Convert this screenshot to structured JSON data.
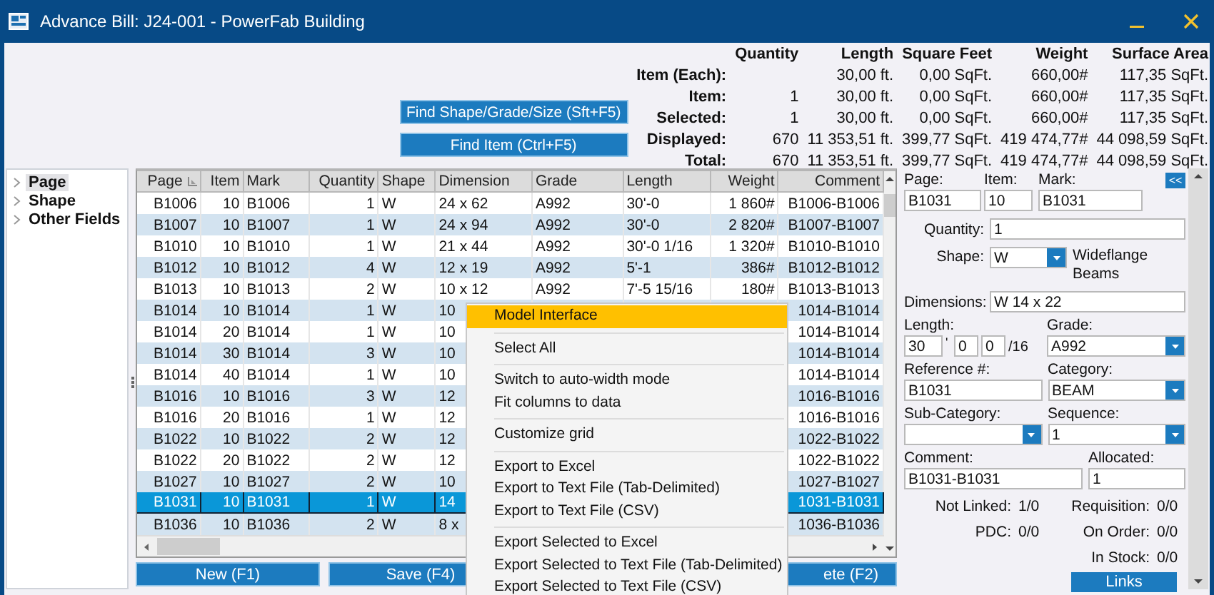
{
  "window": {
    "title": "Advance Bill: J24-001 - PowerFab Building"
  },
  "find_buttons": [
    "Find Shape/Grade/Size (Sft+F5)",
    "Find Item (Ctrl+F5)"
  ],
  "summary": {
    "columns": [
      "Quantity",
      "Length",
      "Square Feet",
      "Weight",
      "Surface Area"
    ],
    "rows": [
      {
        "label": "Item (Each):",
        "length": "30,00 ft.",
        "square_feet": "0,00 SqFt.",
        "weight": "660,00#",
        "surface_area": "117,35 SqFt."
      },
      {
        "label": "Item:",
        "quantity": "1",
        "length": "30,00 ft.",
        "square_feet": "0,00 SqFt.",
        "weight": "660,00#",
        "surface_area": "117,35 SqFt."
      },
      {
        "label": "Selected:",
        "quantity": "1",
        "length": "30,00 ft.",
        "square_feet": "0,00 SqFt.",
        "weight": "660,00#",
        "surface_area": "117,35 SqFt."
      },
      {
        "label": "Displayed:",
        "quantity": "670",
        "length": "11 353,51 ft.",
        "square_feet": "399,77 SqFt.",
        "weight": "419 474,77#",
        "surface_area": "44 098,59 SqFt."
      },
      {
        "label": "Total:",
        "quantity": "670",
        "length": "11 353,51 ft.",
        "square_feet": "399,77 SqFt.",
        "weight": "419 474,77#",
        "surface_area": "44 098,59 SqFt."
      }
    ]
  },
  "tree": [
    {
      "label": "Page",
      "selected": true
    },
    {
      "label": "Shape",
      "selected": false
    },
    {
      "label": "Other Fields",
      "selected": false
    }
  ],
  "grid": {
    "columns": [
      {
        "label": "Page",
        "sorted": true
      },
      {
        "label": "Item",
        "sorted": false
      },
      {
        "label": "Mark",
        "sorted": false
      },
      {
        "label": "Quantity",
        "sorted": false
      },
      {
        "label": "Shape",
        "sorted": false
      },
      {
        "label": "Dimension",
        "sorted": false
      },
      {
        "label": "Grade",
        "sorted": false
      },
      {
        "label": "Length",
        "sorted": false
      },
      {
        "label": "Weight",
        "sorted": false
      },
      {
        "label": "Comment",
        "sorted": false
      }
    ],
    "rows": [
      {
        "page": "B1006",
        "item": "10",
        "mark": "B1006",
        "quantity": "1",
        "shape": "W",
        "dimension": "24 x 62",
        "grade": "A992",
        "length": "30'-0",
        "weight": "1 860#",
        "comment": "B1006-B1006",
        "selected": false
      },
      {
        "page": "B1007",
        "item": "10",
        "mark": "B1007",
        "quantity": "1",
        "shape": "W",
        "dimension": "24 x 94",
        "grade": "A992",
        "length": "30'-0",
        "weight": "2 820#",
        "comment": "B1007-B1007",
        "selected": false
      },
      {
        "page": "B1010",
        "item": "10",
        "mark": "B1010",
        "quantity": "1",
        "shape": "W",
        "dimension": "21 x 44",
        "grade": "A992",
        "length": "30'-0 1/16",
        "weight": "1 320#",
        "comment": "B1010-B1010",
        "selected": false
      },
      {
        "page": "B1012",
        "item": "10",
        "mark": "B1012",
        "quantity": "4",
        "shape": "W",
        "dimension": "12 x 19",
        "grade": "A992",
        "length": "5'-1",
        "weight": "386#",
        "comment": "B1012-B1012",
        "selected": false
      },
      {
        "page": "B1013",
        "item": "10",
        "mark": "B1013",
        "quantity": "2",
        "shape": "W",
        "dimension": "10 x 12",
        "grade": "A992",
        "length": "7'-5 15/16",
        "weight": "180#",
        "comment": "B1013-B1013",
        "selected": false
      },
      {
        "page": "B1014",
        "item": "10",
        "mark": "B1014",
        "quantity": "1",
        "shape": "W",
        "dimension": "10",
        "comment": "1014-B1014",
        "selected": false
      },
      {
        "page": "B1014",
        "item": "20",
        "mark": "B1014",
        "quantity": "1",
        "shape": "W",
        "dimension": "10",
        "comment": "1014-B1014",
        "selected": false
      },
      {
        "page": "B1014",
        "item": "30",
        "mark": "B1014",
        "quantity": "3",
        "shape": "W",
        "dimension": "10",
        "comment": "1014-B1014",
        "selected": false
      },
      {
        "page": "B1014",
        "item": "40",
        "mark": "B1014",
        "quantity": "1",
        "shape": "W",
        "dimension": "10",
        "comment": "1014-B1014",
        "selected": false
      },
      {
        "page": "B1016",
        "item": "10",
        "mark": "B1016",
        "quantity": "3",
        "shape": "W",
        "dimension": "12",
        "comment": "1016-B1016",
        "selected": false
      },
      {
        "page": "B1016",
        "item": "20",
        "mark": "B1016",
        "quantity": "1",
        "shape": "W",
        "dimension": "12",
        "comment": "1016-B1016",
        "selected": false
      },
      {
        "page": "B1022",
        "item": "10",
        "mark": "B1022",
        "quantity": "2",
        "shape": "W",
        "dimension": "12",
        "comment": "1022-B1022",
        "selected": false
      },
      {
        "page": "B1022",
        "item": "20",
        "mark": "B1022",
        "quantity": "2",
        "shape": "W",
        "dimension": "12",
        "comment": "1022-B1022",
        "selected": false
      },
      {
        "page": "B1027",
        "item": "10",
        "mark": "B1027",
        "quantity": "2",
        "shape": "W",
        "dimension": "10",
        "comment": "1027-B1027",
        "selected": false
      },
      {
        "page": "B1031",
        "item": "10",
        "mark": "B1031",
        "quantity": "1",
        "shape": "W",
        "dimension": "14",
        "comment": "1031-B1031",
        "selected": true
      },
      {
        "page": "B1036",
        "item": "10",
        "mark": "B1036",
        "quantity": "2",
        "shape": "W",
        "dimension": "8 x",
        "comment": "1036-B1036",
        "selected": false
      }
    ]
  },
  "grid_buttons": [
    "New (F1)",
    "Save (F4)",
    "ete (F2)"
  ],
  "context_menu": {
    "groups": [
      [
        {
          "label": "Model Interface",
          "highlighted": true
        }
      ],
      [
        {
          "label": "Select All",
          "highlighted": false
        }
      ],
      [
        {
          "label": "Switch to auto-width mode",
          "highlighted": false
        },
        {
          "label": "Fit columns to data",
          "highlighted": false
        }
      ],
      [
        {
          "label": "Customize grid",
          "highlighted": false
        }
      ],
      [
        {
          "label": "Export to Excel",
          "highlighted": false
        },
        {
          "label": "Export to Text File (Tab-Delimited)",
          "highlighted": false
        },
        {
          "label": "Export to Text File (CSV)",
          "highlighted": false
        }
      ],
      [
        {
          "label": "Export Selected to Excel",
          "highlighted": false
        },
        {
          "label": "Export Selected to Text File (Tab-Delimited)",
          "highlighted": false
        },
        {
          "label": "Export Selected to Text File (CSV)",
          "highlighted": false
        }
      ]
    ]
  },
  "detail": {
    "collapse_button": "<<",
    "page": {
      "label": "Page:",
      "value": "B1031"
    },
    "item": {
      "label": "Item:",
      "value": "10"
    },
    "mark": {
      "label": "Mark:",
      "value": "B1031"
    },
    "quantity": {
      "label": "Quantity:",
      "value": "1"
    },
    "shape": {
      "label": "Shape:",
      "value": "W",
      "description": "Wideflange Beams"
    },
    "dimensions": {
      "label": "Dimensions:",
      "value": "W 14 x 22"
    },
    "length": {
      "label": "Length:",
      "feet": "30",
      "feet_mark": "'",
      "inches": "0",
      "sixteenths": "0",
      "unit": "/16"
    },
    "grade": {
      "label": "Grade:",
      "value": "A992"
    },
    "reference": {
      "label": "Reference #:",
      "value": "B1031"
    },
    "category": {
      "label": "Category:",
      "value": "BEAM"
    },
    "sub_category": {
      "label": "Sub-Category:"
    },
    "sequence": {
      "label": "Sequence:",
      "value": "1"
    },
    "comment": {
      "label": "Comment:",
      "value": "B1031-B1031"
    },
    "allocated": {
      "label": "Allocated:",
      "value": "1"
    },
    "stats_left": [
      {
        "label": "Not Linked:",
        "value": "1/0"
      },
      {
        "label": "PDC:",
        "value": "0/0"
      }
    ],
    "stats_right": [
      {
        "label": "Requisition:",
        "value": "0/0"
      },
      {
        "label": "On Order:",
        "value": "0/0"
      },
      {
        "label": "In Stock:",
        "value": "0/0"
      }
    ],
    "links_button": "Links"
  }
}
